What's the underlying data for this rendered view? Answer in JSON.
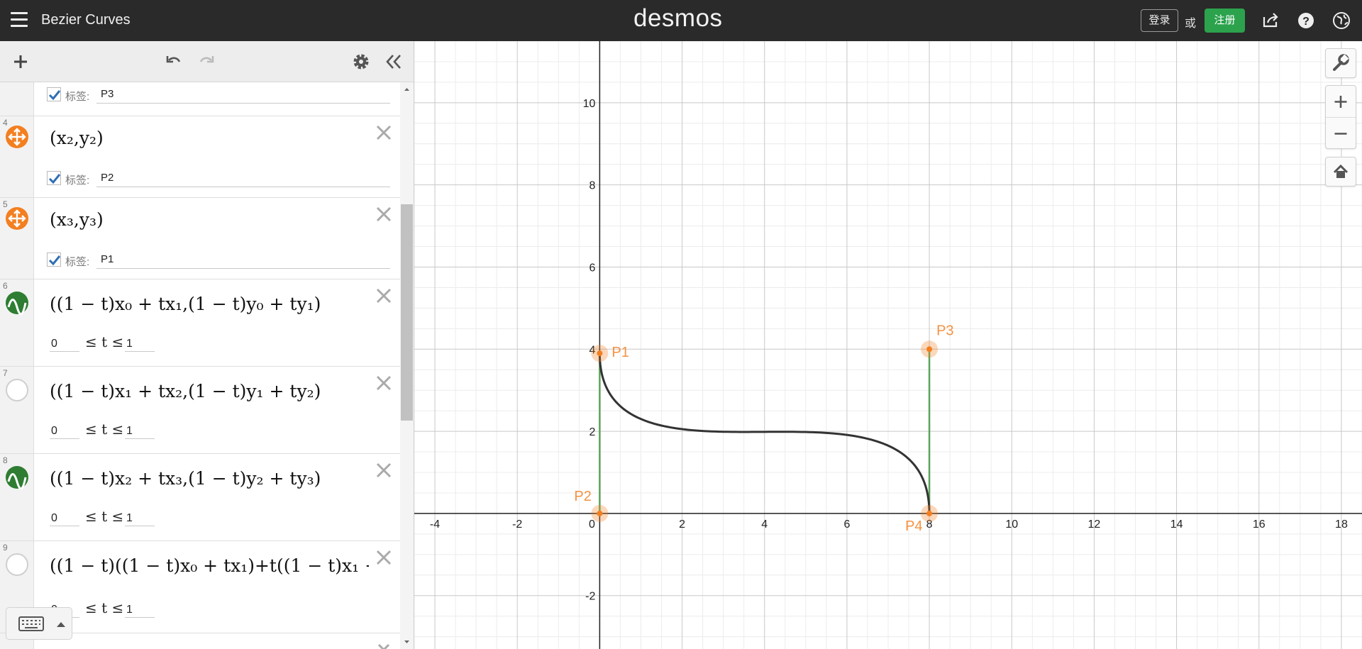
{
  "header": {
    "doc_title": "Bezier Curves",
    "logo": "desmos",
    "login_label": "登录",
    "or_label": "或",
    "signup_label": "注册",
    "icons": [
      "menu-icon",
      "share-icon",
      "help-icon",
      "globe-icon"
    ]
  },
  "toolbar": {
    "icons": [
      "add-icon",
      "undo-icon",
      "redo-icon",
      "gear-icon",
      "collapse-icon"
    ]
  },
  "expressions": {
    "label_word": "标签:",
    "domain_t": "≤ t ≤",
    "e3_label": "P3",
    "e4": {
      "num": "4",
      "math": "(x₂,y₂)",
      "label": "P2"
    },
    "e5": {
      "num": "5",
      "math": "(x₃,y₃)",
      "label": "P1"
    },
    "e6": {
      "num": "6",
      "math": "((1 − t)x₀ + tx₁,(1 − t)y₀ + ty₁)",
      "min": "0",
      "max": "1"
    },
    "e7": {
      "num": "7",
      "math": "((1 − t)x₁ + tx₂,(1 − t)y₁ + ty₂)",
      "min": "0",
      "max": "1"
    },
    "e8": {
      "num": "8",
      "math": "((1 − t)x₂ + tx₃,(1 − t)y₂ + ty₃)",
      "min": "0",
      "max": "1"
    },
    "e9": {
      "num": "9",
      "math": "((1 − t)((1 − t)x₀ + tx₁)+t((1 − t)x₁ + ",
      "min": "0",
      "max": "1"
    }
  },
  "colors": {
    "point_orange": "#f37f20",
    "curve_green": "#2e7d32",
    "curve_black": "#333333",
    "segment_green": "#5aa35a",
    "header_bg": "#2a2a2a",
    "signup_green": "#2ca24d"
  },
  "chart_data": {
    "type": "line",
    "x_range": [
      -4.5,
      18.5
    ],
    "y_range": [
      -3.3,
      11.5
    ],
    "x_ticks": [
      -4,
      -2,
      0,
      2,
      4,
      6,
      8,
      10,
      12,
      14,
      16,
      18
    ],
    "y_ticks": [
      -2,
      2,
      4,
      6,
      8,
      10
    ],
    "x_tick_labels": [
      "-4",
      "-2",
      "0",
      "2",
      "4",
      "6",
      "8",
      "10",
      "12",
      "14",
      "16",
      "18"
    ],
    "y_tick_labels": [
      "-2",
      "2",
      "4",
      "6",
      "8",
      "10"
    ],
    "grid": true,
    "points": [
      {
        "label": "P1",
        "x": 0,
        "y": 3.9
      },
      {
        "label": "P2",
        "x": 0,
        "y": 0
      },
      {
        "label": "P3",
        "x": 8,
        "y": 4
      },
      {
        "label": "P4",
        "x": 8,
        "y": 0
      }
    ],
    "segments": [
      {
        "from": [
          0,
          0
        ],
        "to": [
          0,
          3.9
        ]
      },
      {
        "from": [
          8,
          0
        ],
        "to": [
          8,
          4
        ]
      }
    ],
    "bezier": {
      "p0": [
        0,
        3.9
      ],
      "p1": [
        0,
        0
      ],
      "p2": [
        8,
        4
      ],
      "p3": [
        8,
        0
      ]
    }
  }
}
